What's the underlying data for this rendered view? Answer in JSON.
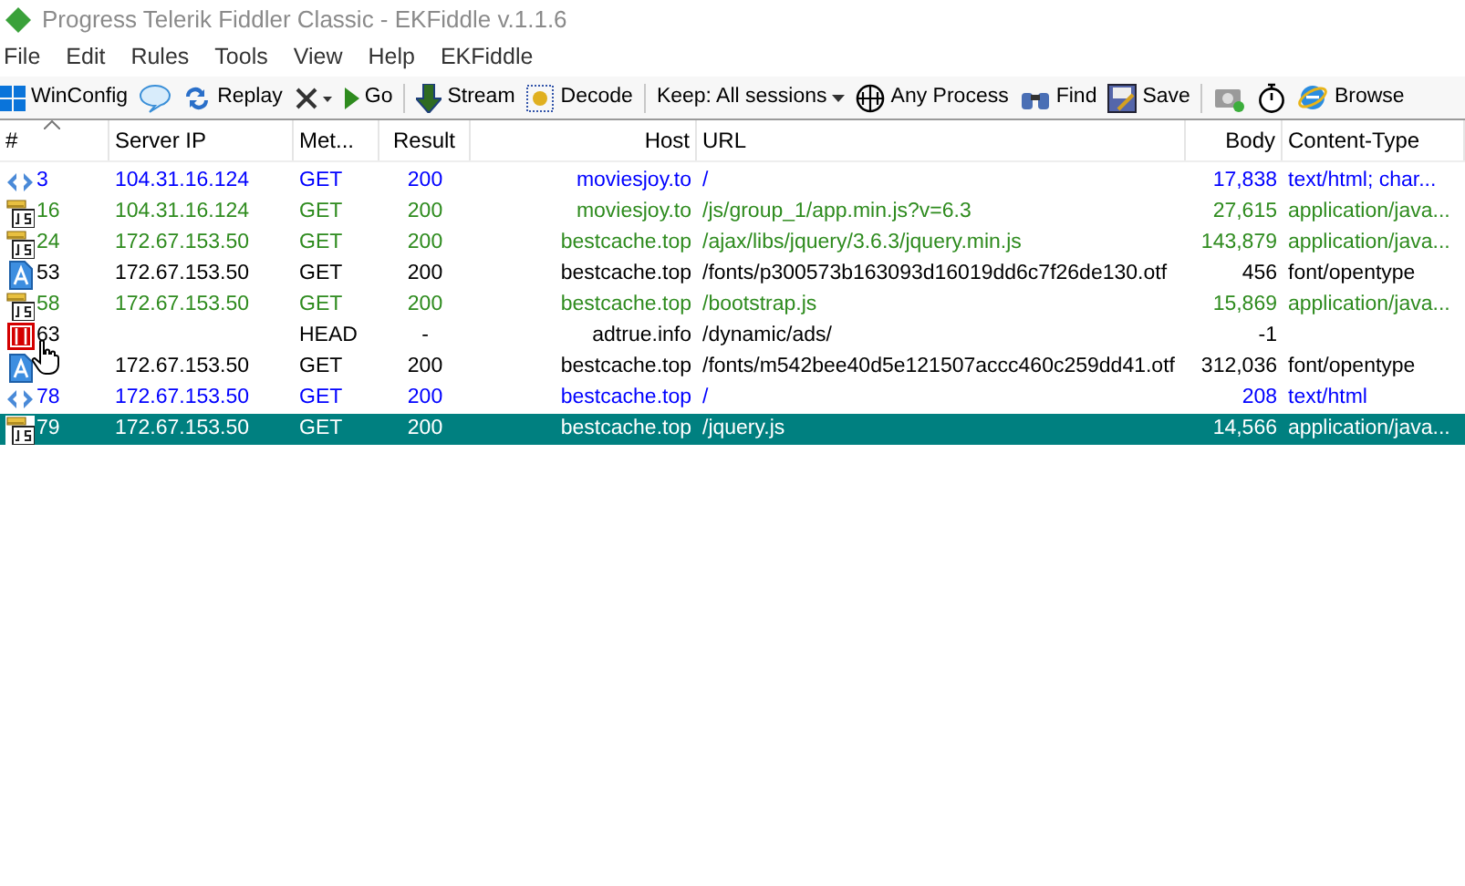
{
  "window": {
    "title": "Progress Telerik Fiddler Classic - EKFiddle v.1.1.6"
  },
  "menu": [
    "File",
    "Edit",
    "Rules",
    "Tools",
    "View",
    "Help",
    "EKFiddle"
  ],
  "toolbar": [
    {
      "kind": "winconfig",
      "label": "WinConfig"
    },
    {
      "kind": "comment"
    },
    {
      "kind": "replay",
      "label": "Replay"
    },
    {
      "kind": "remove"
    },
    {
      "kind": "go",
      "label": "Go"
    },
    {
      "kind": "separator"
    },
    {
      "kind": "stream",
      "label": "Stream"
    },
    {
      "kind": "decode",
      "label": "Decode"
    },
    {
      "kind": "separator"
    },
    {
      "kind": "keep",
      "label": "Keep: All sessions"
    },
    {
      "kind": "process",
      "label": "Any Process"
    },
    {
      "kind": "find",
      "label": "Find"
    },
    {
      "kind": "save",
      "label": "Save"
    },
    {
      "kind": "separator"
    },
    {
      "kind": "screenshot"
    },
    {
      "kind": "timer"
    },
    {
      "kind": "browse",
      "label": "Browse"
    }
  ],
  "table": {
    "columns": [
      "#",
      "Server IP",
      "Met...",
      "Result",
      "Host",
      "URL",
      "Body",
      "Content-Type"
    ],
    "rows": [
      {
        "kind": "html",
        "color": "#0000ff",
        "selected": false,
        "cells": [
          "3",
          "104.31.16.124",
          "GET",
          "200",
          "moviesjoy.to",
          "/",
          "17,838",
          "text/html; char..."
        ]
      },
      {
        "kind": "js",
        "color": "#2e8b1e",
        "selected": false,
        "cells": [
          "16",
          "104.31.16.124",
          "GET",
          "200",
          "moviesjoy.to",
          "/js/group_1/app.min.js?v=6.3",
          "27,615",
          "application/java..."
        ]
      },
      {
        "kind": "js",
        "color": "#2e8b1e",
        "selected": false,
        "cells": [
          "24",
          "172.67.153.50",
          "GET",
          "200",
          "bestcache.top",
          "/ajax/libs/jquery/3.6.3/jquery.min.js",
          "143,879",
          "application/java..."
        ]
      },
      {
        "kind": "font",
        "color": "#000000",
        "selected": false,
        "cells": [
          "53",
          "172.67.153.50",
          "GET",
          "200",
          "bestcache.top",
          "/fonts/p300573b163093d16019dd6c7f26de130.otf",
          "456",
          "font/opentype"
        ]
      },
      {
        "kind": "js",
        "color": "#2e8b1e",
        "selected": false,
        "cells": [
          "58",
          "172.67.153.50",
          "GET",
          "200",
          "bestcache.top",
          "/bootstrap.js",
          "15,869",
          "application/java..."
        ]
      },
      {
        "kind": "blocked",
        "color": "#000000",
        "selected": false,
        "cells": [
          "63",
          "",
          "HEAD",
          "-",
          "adtrue.info",
          "/dynamic/ads/",
          "-1",
          ""
        ]
      },
      {
        "kind": "font",
        "color": "#000000",
        "selected": false,
        "cells": [
          "",
          "172.67.153.50",
          "GET",
          "200",
          "bestcache.top",
          "/fonts/m542bee40d5e121507accc460c259dd41.otf",
          "312,036",
          "font/opentype"
        ]
      },
      {
        "kind": "html",
        "color": "#0000ff",
        "selected": false,
        "cells": [
          "78",
          "172.67.153.50",
          "GET",
          "200",
          "bestcache.top",
          "/",
          "208",
          "text/html"
        ]
      },
      {
        "kind": "js",
        "selected": true,
        "cells": [
          "79",
          "172.67.153.50",
          "GET",
          "200",
          "bestcache.top",
          "/jquery.js",
          "14,566",
          "application/java..."
        ]
      }
    ]
  }
}
